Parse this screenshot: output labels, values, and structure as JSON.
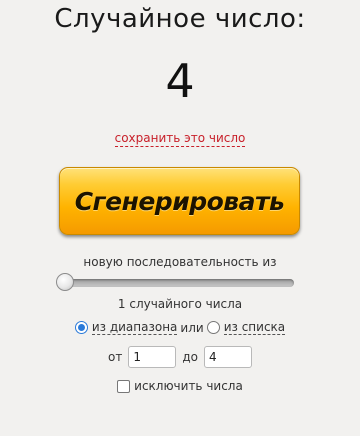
{
  "title": "Случайное число:",
  "result": "4",
  "save_link": "сохранить это число",
  "generate_button": "Сгенерировать",
  "sequence_label": "новую последовательность из",
  "count": {
    "value": 1,
    "label": "1 случайного числа"
  },
  "mode": {
    "range_option": "из диапазона",
    "or_text": "или",
    "list_option": "из списка",
    "selected": "range"
  },
  "range": {
    "from_label": "от",
    "from_value": "1",
    "to_label": "до",
    "to_value": "4"
  },
  "exclude_label": "исключить числа",
  "colors": {
    "accent_link": "#c8202a",
    "button_orange": "#ffb300",
    "radio_blue": "#2a7ad9"
  }
}
